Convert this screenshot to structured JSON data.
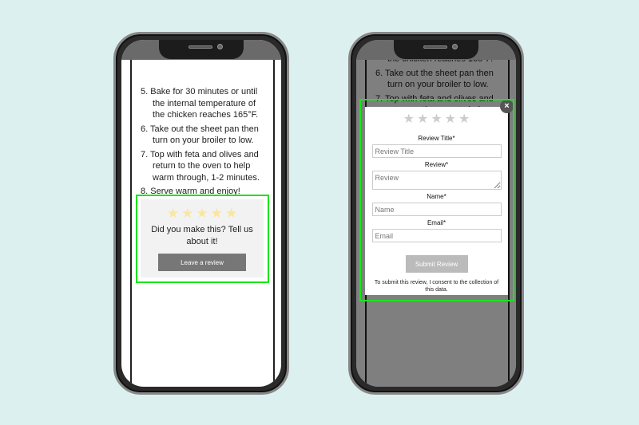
{
  "recipe_steps": [
    {
      "num": "5.",
      "text": "Bake for 30 minutes or until the internal temperature of the chicken reaches 165°F."
    },
    {
      "num": "6.",
      "text": "Take out the sheet pan then turn on your broiler to low."
    },
    {
      "num": "7.",
      "text": "Top with feta and olives and return to the oven to help warm through, 1-2 minutes."
    },
    {
      "num": "8.",
      "text": "Serve warm and enjoy!"
    }
  ],
  "review_card": {
    "rating": 0,
    "star_color": "#f9e6a0",
    "prompt": "Did you make this? Tell us about it!",
    "button": "Leave a review"
  },
  "review_modal": {
    "rating": 0,
    "star_color": "#cccccc",
    "close": "×",
    "title_label": "Review Title*",
    "title_placeholder": "Review Title",
    "review_label": "Review*",
    "review_placeholder": "Review",
    "name_label": "Name*",
    "name_placeholder": "Name",
    "email_label": "Email*",
    "email_placeholder": "Email",
    "submit": "Submit Review",
    "consent": "To submit this review, I consent to the collection of this data."
  },
  "highlight_color": "#19e619"
}
